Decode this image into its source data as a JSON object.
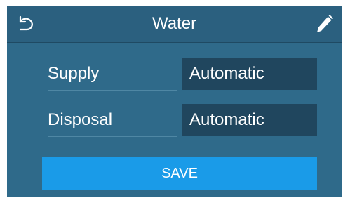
{
  "header": {
    "title": "Water",
    "back_icon": "back-arrow-icon",
    "edit_icon": "pencil-icon"
  },
  "settings": [
    {
      "label": "Supply",
      "value": "Automatic"
    },
    {
      "label": "Disposal",
      "value": "Automatic"
    }
  ],
  "save_label": "SAVE",
  "colors": {
    "background": "#2f6a8a",
    "header": "#2b607f",
    "value_field": "#20465e",
    "save_button": "#1a9be8",
    "text": "#ffffff"
  }
}
